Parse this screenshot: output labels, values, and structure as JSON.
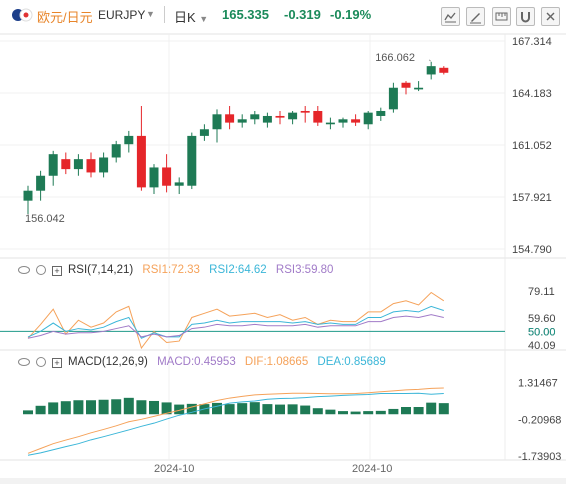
{
  "header": {
    "pair_cn": "欧元/日元",
    "pair_code": "EURJPY",
    "period": "日K",
    "price": "165.335",
    "change": "-0.319",
    "change_pct": "-0.19%"
  },
  "toolbar": [
    "chart-icon",
    "draw-icon",
    "measure-icon",
    "magnet-icon",
    "close-icon"
  ],
  "colors": {
    "up": "#1e7a55",
    "down": "#e5262a",
    "rsi1": "#f5a25a",
    "rsi2": "#3bb6d8",
    "rsi3": "#a17bc8",
    "dif": "#f5a25a",
    "dea": "#3bb6d8",
    "bar": "#1e7a55"
  },
  "chart_data": [
    {
      "type": "candlestick",
      "ylim": [
        154.79,
        167.314
      ],
      "y_ticks": [
        "167.314",
        "164.183",
        "161.052",
        "157.921",
        "154.790"
      ],
      "annotations": {
        "high": "166.062",
        "low": "156.042"
      },
      "x_labels": [
        "2024-10",
        "2024-10"
      ],
      "candles": [
        [
          157.7,
          158.3,
          156.9,
          158.6
        ],
        [
          158.3,
          159.2,
          157.7,
          159.5
        ],
        [
          159.2,
          160.5,
          158.6,
          160.7
        ],
        [
          160.2,
          159.6,
          159.3,
          160.6
        ],
        [
          159.6,
          160.2,
          159.2,
          160.5
        ],
        [
          160.2,
          159.4,
          159.1,
          160.6
        ],
        [
          159.4,
          160.3,
          159.1,
          160.6
        ],
        [
          160.3,
          161.1,
          160.0,
          161.3
        ],
        [
          161.1,
          161.6,
          160.6,
          161.9
        ],
        [
          161.6,
          158.5,
          158.3,
          163.4
        ],
        [
          158.5,
          159.7,
          158.1,
          159.9
        ],
        [
          159.7,
          158.6,
          158.2,
          160.5
        ],
        [
          158.6,
          158.8,
          158.1,
          159.1
        ],
        [
          158.6,
          161.6,
          158.4,
          161.8
        ],
        [
          161.6,
          162.0,
          161.3,
          162.3
        ],
        [
          162.0,
          162.9,
          161.2,
          163.2
        ],
        [
          162.9,
          162.4,
          162.0,
          163.4
        ],
        [
          162.4,
          162.6,
          162.1,
          162.9
        ],
        [
          162.6,
          162.9,
          162.3,
          163.1
        ],
        [
          162.4,
          162.8,
          162.1,
          163.0
        ],
        [
          162.8,
          162.7,
          162.3,
          163.1
        ],
        [
          162.6,
          163.0,
          162.3,
          163.1
        ],
        [
          163.1,
          163.0,
          162.4,
          163.4
        ],
        [
          163.1,
          162.4,
          162.2,
          163.4
        ],
        [
          162.3,
          162.4,
          162.0,
          162.7
        ],
        [
          162.4,
          162.6,
          162.1,
          162.7
        ],
        [
          162.6,
          162.4,
          162.2,
          162.9
        ],
        [
          162.3,
          163.0,
          162.0,
          163.1
        ],
        [
          162.8,
          163.1,
          162.5,
          163.3
        ],
        [
          163.2,
          164.5,
          163.0,
          164.8
        ],
        [
          164.8,
          164.5,
          164.1,
          164.9
        ],
        [
          164.4,
          164.5,
          164.3,
          164.9
        ],
        [
          165.3,
          165.8,
          165.0,
          166.062
        ],
        [
          165.7,
          165.4,
          165.3,
          165.8
        ]
      ]
    },
    {
      "type": "line",
      "title": "RSI(7,14,21)",
      "series": [
        {
          "name": "RSI1",
          "label": "RSI1:72.33",
          "values": [
            45,
            55,
            66,
            48,
            58,
            53,
            56,
            64,
            68,
            38,
            50,
            42,
            43,
            60,
            63,
            66,
            61,
            62,
            63,
            60,
            62,
            58,
            60,
            55,
            58,
            57,
            57,
            64,
            64,
            70,
            72,
            69,
            78,
            72
          ]
        },
        {
          "name": "RSI2",
          "label": "RSI2:64.62",
          "values": [
            46,
            50,
            56,
            50,
            52,
            51,
            53,
            57,
            60,
            45,
            49,
            46,
            46,
            55,
            56,
            58,
            56,
            57,
            57,
            57,
            57,
            56,
            57,
            55,
            56,
            55,
            55,
            60,
            60,
            64,
            65,
            64,
            68,
            65
          ]
        },
        {
          "name": "RSI3",
          "label": "RSI3:59.80",
          "values": [
            45,
            47,
            50,
            48,
            49,
            49,
            50,
            52,
            54,
            46,
            48,
            46,
            47,
            52,
            53,
            55,
            54,
            54,
            55,
            54,
            54,
            54,
            55,
            53,
            54,
            54,
            54,
            57,
            57,
            60,
            61,
            60,
            62,
            60
          ]
        }
      ],
      "ylim": [
        38,
        87
      ],
      "y_ticks": [
        "79.11",
        "59.60",
        "50.00",
        "40.09"
      ],
      "ref_line": 50
    },
    {
      "type": "bar+line",
      "title": "MACD(12,26,9)",
      "series": [
        {
          "name": "MACD",
          "label": "MACD:0.45953",
          "values": [
            0.16,
            0.35,
            0.49,
            0.54,
            0.58,
            0.58,
            0.6,
            0.62,
            0.68,
            0.58,
            0.55,
            0.49,
            0.4,
            0.43,
            0.42,
            0.47,
            0.42,
            0.46,
            0.5,
            0.42,
            0.4,
            0.41,
            0.36,
            0.25,
            0.19,
            0.13,
            0.11,
            0.13,
            0.14,
            0.22,
            0.3,
            0.3,
            0.48,
            0.46
          ]
        },
        {
          "name": "DIF",
          "label": "DIF:1.08665",
          "values": [
            -1.62,
            -1.42,
            -1.22,
            -1.07,
            -0.93,
            -0.77,
            -0.63,
            -0.48,
            -0.31,
            -0.21,
            -0.09,
            0.04,
            0.16,
            0.3,
            0.43,
            0.57,
            0.67,
            0.74,
            0.8,
            0.83,
            0.85,
            0.87,
            0.87,
            0.86,
            0.85,
            0.85,
            0.86,
            0.89,
            0.93,
            0.97,
            1.01,
            1.03,
            1.07,
            1.087
          ]
        },
        {
          "name": "DEA",
          "label": "DEA:0.85689",
          "values": [
            -1.7,
            -1.6,
            -1.47,
            -1.34,
            -1.22,
            -1.06,
            -0.93,
            -0.79,
            -0.65,
            -0.5,
            -0.37,
            -0.2,
            -0.04,
            0.08,
            0.22,
            0.33,
            0.46,
            0.51,
            0.55,
            0.62,
            0.65,
            0.66,
            0.69,
            0.73,
            0.75,
            0.78,
            0.8,
            0.82,
            0.86,
            0.86,
            0.86,
            0.87,
            0.83,
            0.857
          ]
        }
      ],
      "ylim": [
        -1.73,
        1.75
      ],
      "y_ticks": [
        "1.31467",
        "-0.20968",
        "-1.73903"
      ]
    }
  ]
}
